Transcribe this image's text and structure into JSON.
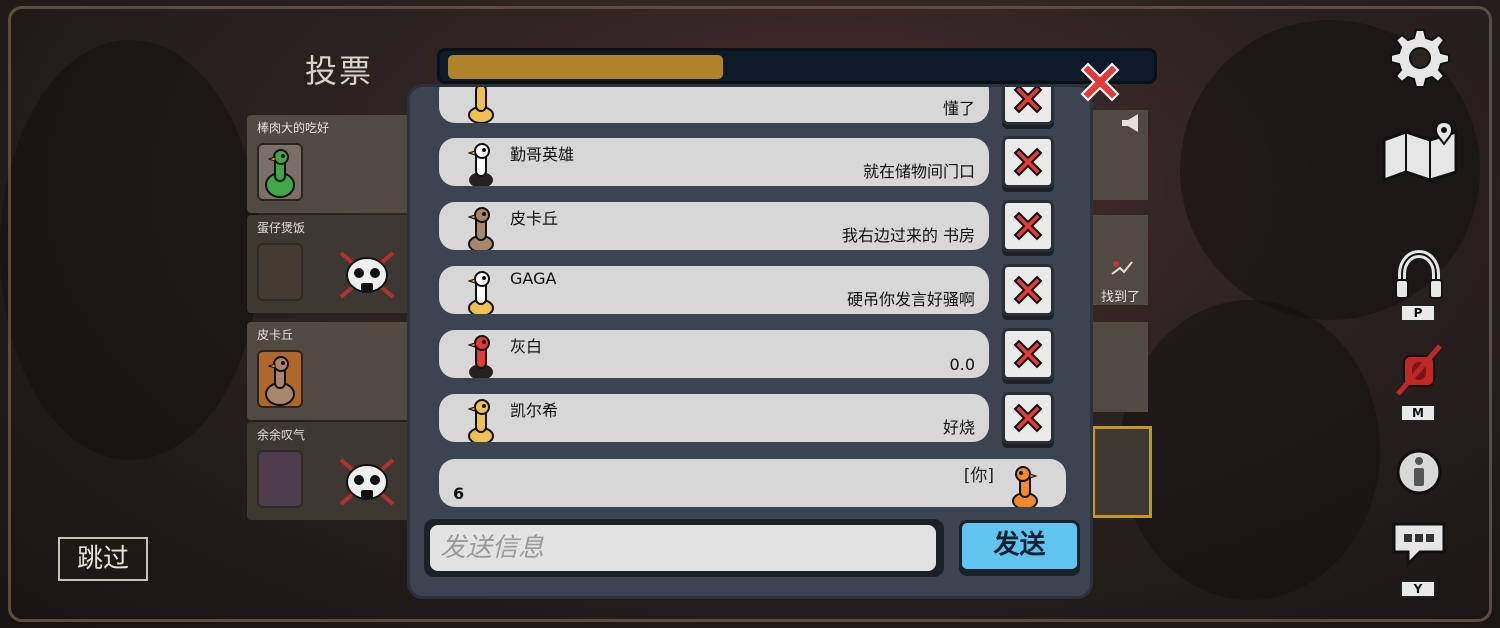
{
  "header": {
    "vote_title": "投票",
    "timer_progress": 0.39
  },
  "players": [
    {
      "name": "棒肉大的吃好",
      "alive": true,
      "color": "#3fa64a"
    },
    {
      "name": "蛋仔煲饭",
      "alive": false,
      "color": "#6b6b6b"
    },
    {
      "name": "皮卡丘",
      "alive": true,
      "color": "#a36b3a"
    },
    {
      "name": "余余叹气",
      "alive": false,
      "color": "#8a5fa0"
    }
  ],
  "right_card": {
    "found_label": "找到了"
  },
  "skip_button": {
    "label": "跳过"
  },
  "right_icons": {
    "settings": "gear-icon",
    "map": "map-icon",
    "headphones_key": "P",
    "mic_key": "M",
    "info": "info-icon",
    "chat_key": "Y"
  },
  "chat": {
    "messages": [
      {
        "sender": "",
        "text": "懂了",
        "goose_color": "#f0c050"
      },
      {
        "sender": "勤哥英雄",
        "text": "就在储物间门口",
        "goose_color": "#ffffff"
      },
      {
        "sender": "皮卡丘",
        "text": "我右边过来的 书房",
        "goose_color": "#a7866c"
      },
      {
        "sender": "GAGA",
        "text": "硬吊你发言好骚啊",
        "goose_color": "#ffffff"
      },
      {
        "sender": "灰白",
        "text": "0.0",
        "goose_color": "#e33a3a"
      },
      {
        "sender": "凯尔希",
        "text": "好烧",
        "goose_color": "#f0c050"
      }
    ],
    "my_message": {
      "text": "6",
      "you_label": "[你]",
      "goose_color": "#f08a2a"
    },
    "input_placeholder": "发送信息",
    "send_label": "发送"
  }
}
